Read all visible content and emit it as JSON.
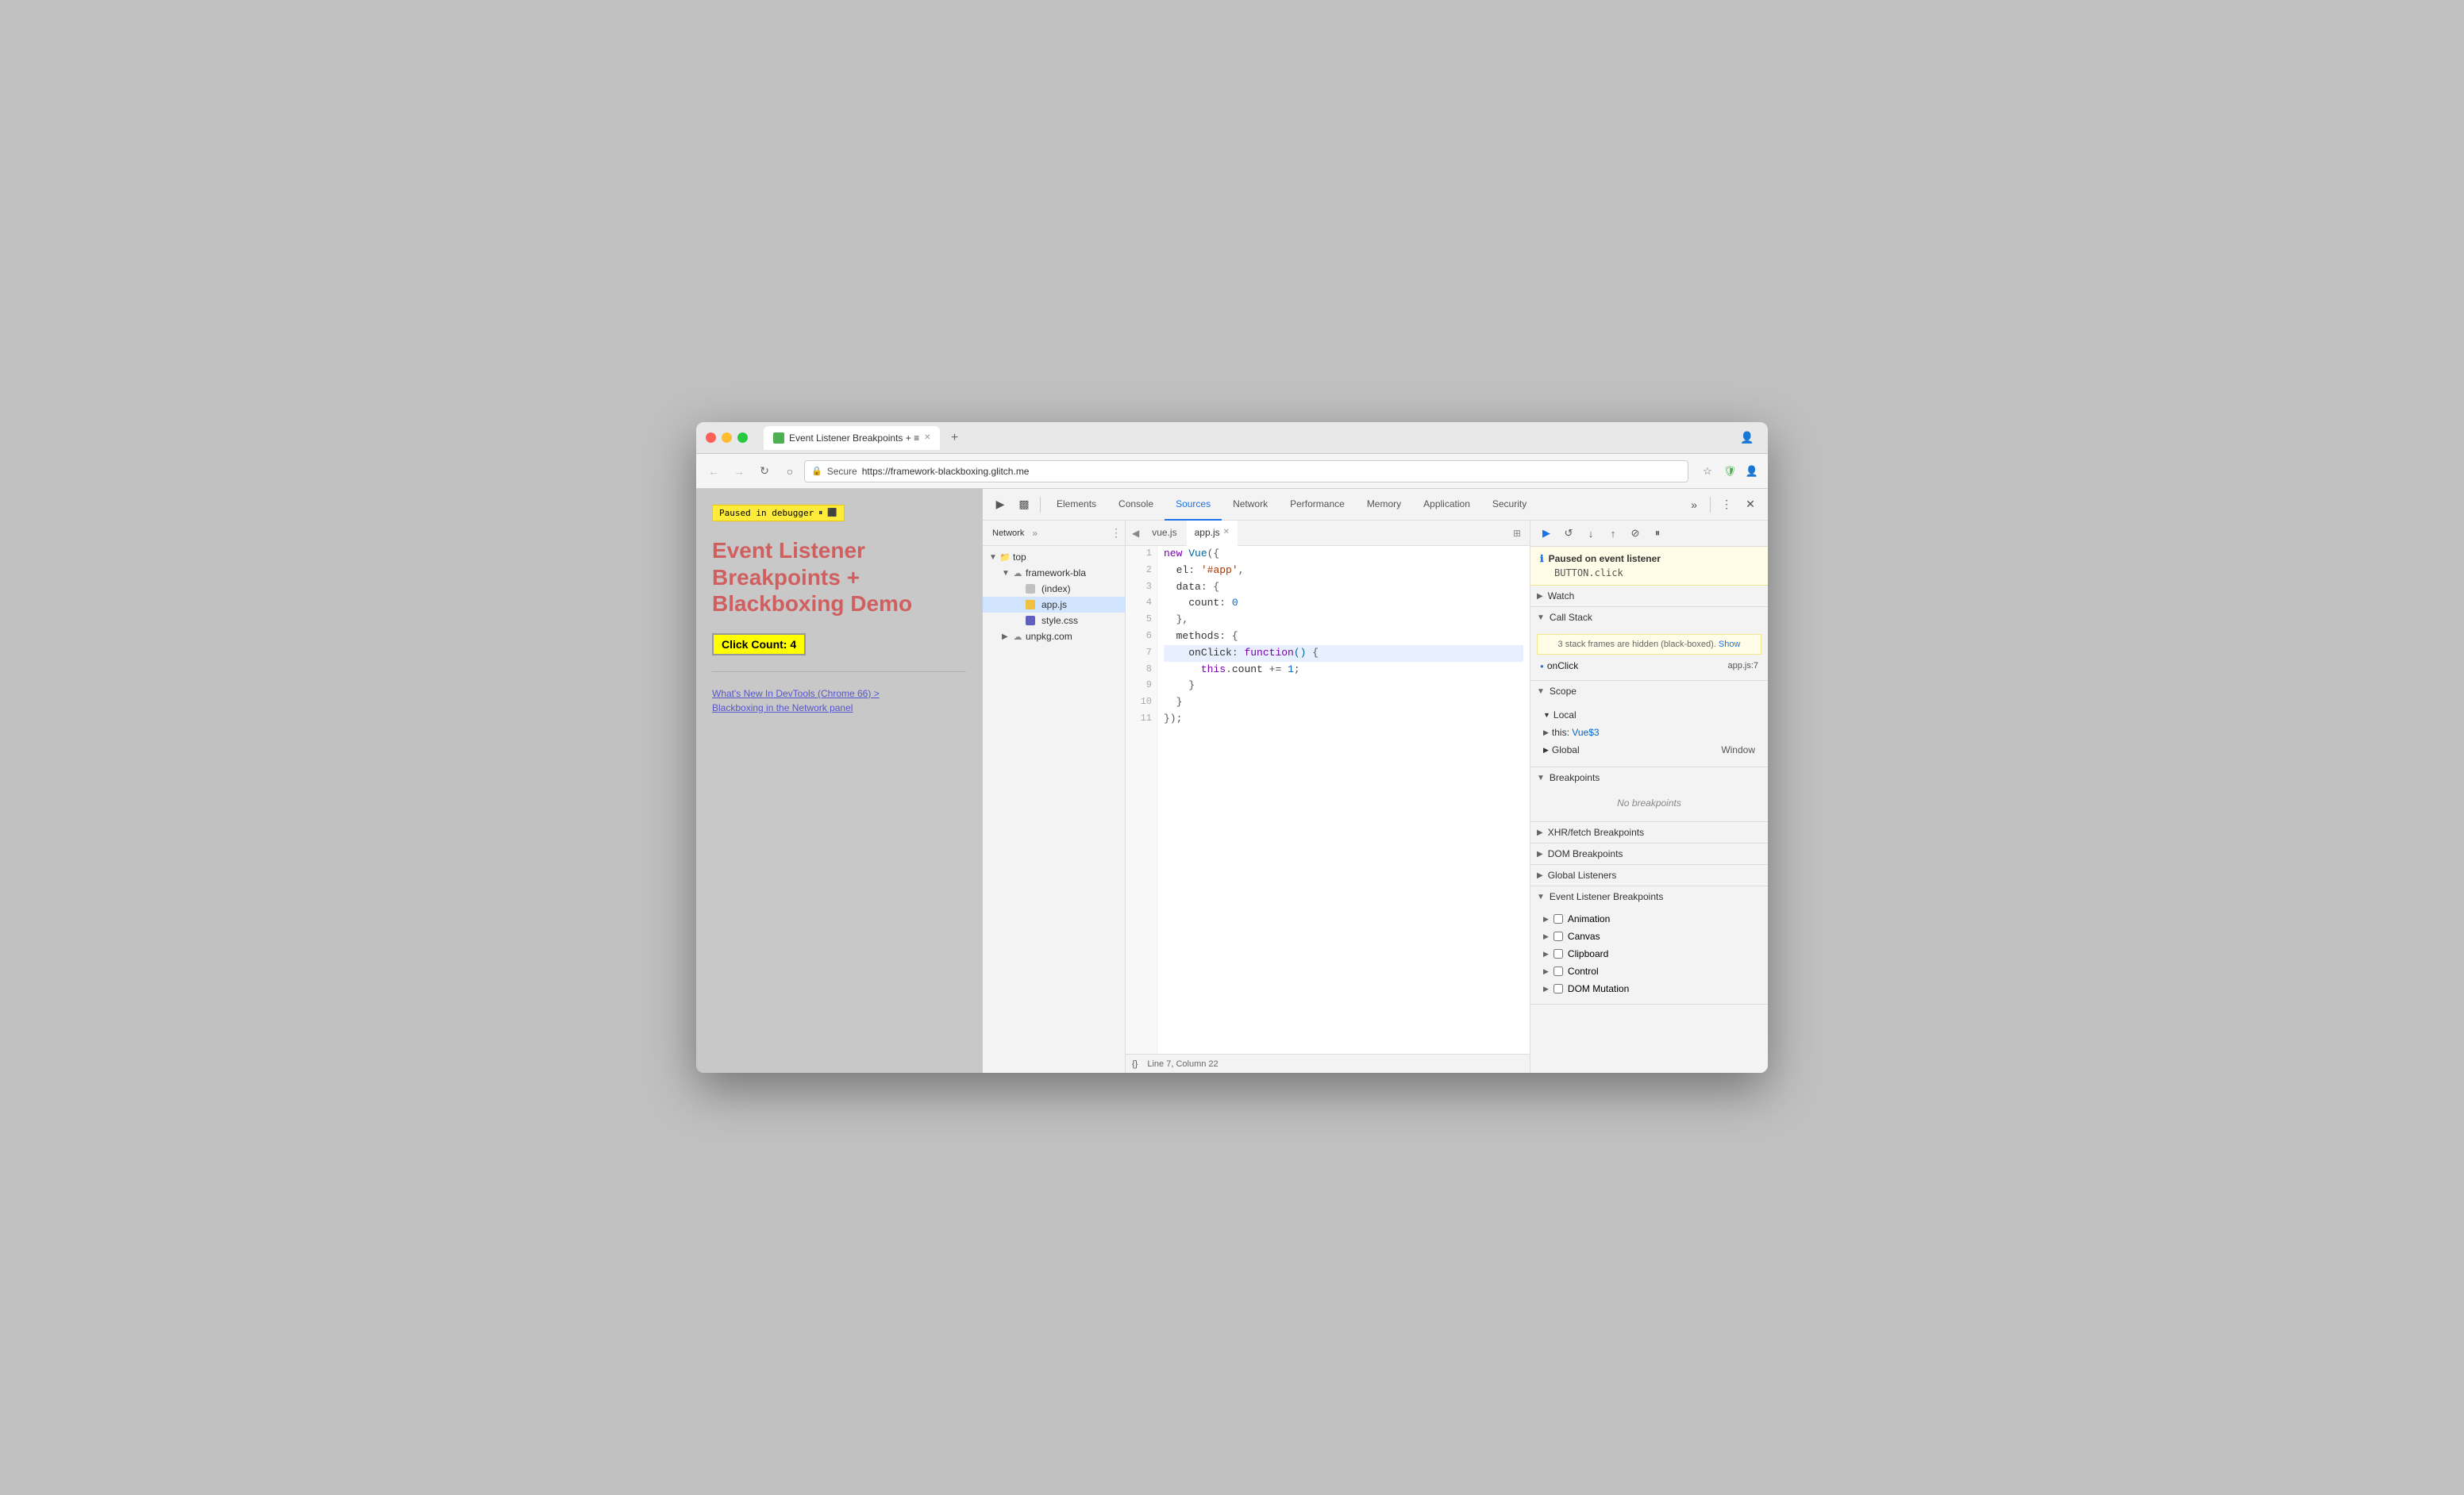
{
  "window": {
    "title": "Event Listener Breakpoints + Blackboxing Demo",
    "tab_label": "Event Listener Breakpoints + ≡",
    "url": "https://framework-blackboxing.glitch.me",
    "url_display": "https://framework-blackboxing.glitch.me"
  },
  "webpage": {
    "debugger_badge": "Paused in debugger",
    "title_line1": "Event Listener",
    "title_line2": "Breakpoints +",
    "title_line3": "Blackboxing Demo",
    "click_count": "Click Count: 4",
    "link1": "What's New In DevTools (Chrome 66) >",
    "link2": "Blackboxing in the Network panel"
  },
  "devtools": {
    "tabs": [
      "Elements",
      "Console",
      "Sources",
      "Network",
      "Performance",
      "Memory",
      "Application",
      "Security"
    ],
    "active_tab": "Sources",
    "more_label": "»",
    "close_label": "✕"
  },
  "sources_sidebar": {
    "tabs": [
      "Network"
    ],
    "more_label": "»",
    "tree": [
      {
        "label": "top",
        "type": "folder",
        "indent": 0,
        "expanded": true
      },
      {
        "label": "framework-bla",
        "type": "cloud",
        "indent": 1,
        "expanded": true
      },
      {
        "label": "(index)",
        "type": "html",
        "indent": 2
      },
      {
        "label": "app.js",
        "type": "js_yellow",
        "indent": 2
      },
      {
        "label": "style.css",
        "type": "css",
        "indent": 2
      },
      {
        "label": "unpkg.com",
        "type": "cloud",
        "indent": 1,
        "expanded": false
      }
    ]
  },
  "editor": {
    "tabs": [
      "vue.js",
      "app.js"
    ],
    "active_tab": "app.js",
    "status": "Line 7, Column 22",
    "code_lines": [
      {
        "num": 1,
        "code": "new Vue({",
        "highlighted": false
      },
      {
        "num": 2,
        "code": "  el: '#app',",
        "highlighted": false
      },
      {
        "num": 3,
        "code": "  data: {",
        "highlighted": false
      },
      {
        "num": 4,
        "code": "    count: 0",
        "highlighted": false
      },
      {
        "num": 5,
        "code": "  },",
        "highlighted": false
      },
      {
        "num": 6,
        "code": "  methods: {",
        "highlighted": false
      },
      {
        "num": 7,
        "code": "    onClick: function() {",
        "highlighted": true
      },
      {
        "num": 8,
        "code": "      this.count += 1;",
        "highlighted": false
      },
      {
        "num": 9,
        "code": "    }",
        "highlighted": false
      },
      {
        "num": 10,
        "code": "  }",
        "highlighted": false
      },
      {
        "num": 11,
        "code": "});",
        "highlighted": false
      }
    ]
  },
  "debugger": {
    "paused_title": "Paused on event listener",
    "paused_subtitle": "BUTTON.click",
    "watch_label": "Watch",
    "callstack_label": "Call Stack",
    "callstack_warning": "3 stack frames are hidden (black-boxed).",
    "callstack_show": "Show",
    "callstack_item": "onClick",
    "callstack_file": "app.js:7",
    "scope_label": "Scope",
    "local_label": "Local",
    "this_label": "this",
    "this_value": "Vue$3",
    "global_label": "Global",
    "global_value": "Window",
    "breakpoints_label": "Breakpoints",
    "no_breakpoints": "No breakpoints",
    "xhr_label": "XHR/fetch Breakpoints",
    "dom_label": "DOM Breakpoints",
    "global_listeners_label": "Global Listeners",
    "el_breakpoints_label": "Event Listener Breakpoints",
    "el_categories": [
      "Animation",
      "Canvas",
      "Clipboard",
      "Control",
      "DOM Mutation"
    ]
  }
}
